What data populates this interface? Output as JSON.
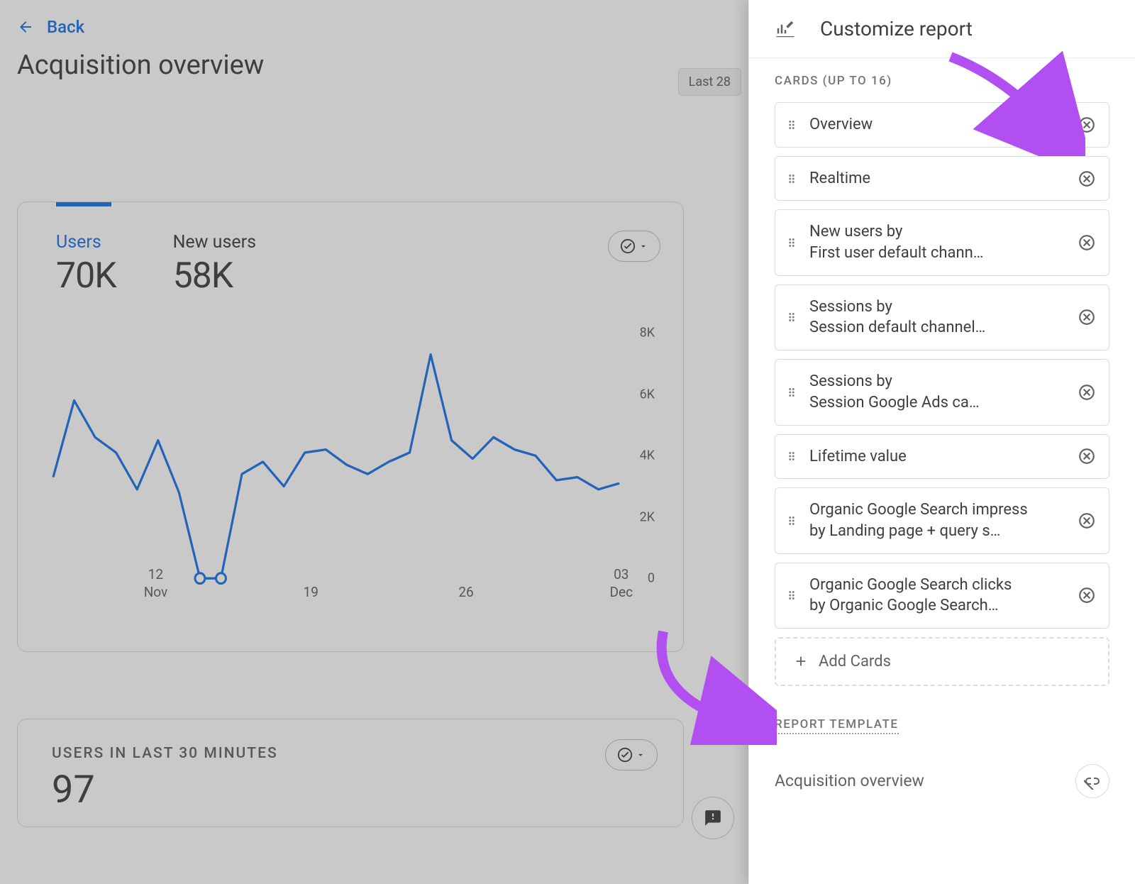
{
  "header": {
    "back_label": "Back",
    "page_title": "Acquisition overview",
    "date_pill": "Last 28"
  },
  "overview_card": {
    "metric1_label": "Users",
    "metric1_value": "70K",
    "metric2_label": "New users",
    "metric2_value": "58K",
    "y_ticks": [
      "0",
      "2K",
      "4K",
      "6K",
      "8K"
    ],
    "x_ticks": [
      {
        "top": "12",
        "bottom": "Nov"
      },
      {
        "top": "19",
        "bottom": ""
      },
      {
        "top": "26",
        "bottom": ""
      },
      {
        "top": "03",
        "bottom": "Dec"
      }
    ]
  },
  "realtime_card": {
    "title": "USERS IN LAST 30 MINUTES",
    "value": "97"
  },
  "panel": {
    "title": "Customize report",
    "cards_section_label": "CARDS (UP TO 16)",
    "add_cards_label": "Add Cards",
    "template_section_label": "REPORT TEMPLATE",
    "template_name": "Acquisition overview",
    "cards": [
      {
        "line1": "Overview",
        "line2": ""
      },
      {
        "line1": "Realtime",
        "line2": ""
      },
      {
        "line1": "New users by",
        "line2": "First user default chann…"
      },
      {
        "line1": "Sessions by",
        "line2": "Session default channel…"
      },
      {
        "line1": "Sessions by",
        "line2": "Session Google Ads ca…"
      },
      {
        "line1": "Lifetime value",
        "line2": ""
      },
      {
        "line1": "Organic Google Search impress",
        "line2": "by Landing page + query s…"
      },
      {
        "line1": "Organic Google Search clicks",
        "line2": "by Organic Google Search…"
      }
    ]
  },
  "chart_data": {
    "type": "line",
    "title": "",
    "xlabel": "",
    "ylabel": "",
    "ylim": [
      0,
      8000
    ],
    "x": [
      1,
      2,
      3,
      4,
      5,
      6,
      7,
      8,
      9,
      10,
      11,
      12,
      13,
      14,
      15,
      16,
      17,
      18,
      19,
      20,
      21,
      22,
      23,
      24,
      25,
      26,
      27,
      28
    ],
    "series": [
      {
        "name": "Users",
        "values": [
          3300,
          5800,
          4600,
          4100,
          2900,
          4500,
          2800,
          0,
          0,
          3400,
          3800,
          3000,
          4100,
          4200,
          3700,
          3400,
          3800,
          4100,
          7300,
          4500,
          3900,
          4600,
          4200,
          4000,
          3200,
          3300,
          2900,
          3100
        ]
      }
    ],
    "x_tick_labels": [
      "12 Nov",
      "19",
      "26",
      "03 Dec"
    ],
    "y_tick_labels": [
      "0",
      "2K",
      "4K",
      "6K",
      "8K"
    ]
  }
}
